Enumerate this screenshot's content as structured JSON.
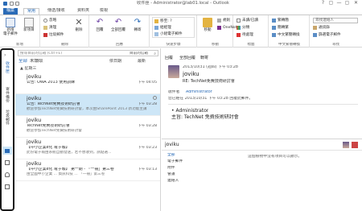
{
  "window": {
    "title": "收件匣 - Administrator@lab01.local - Outlook",
    "controls": [
      "?",
      "▢",
      "—",
      "▢",
      "✕"
    ]
  },
  "tabs": [
    {
      "label": "檔案"
    },
    {
      "label": "常用"
    },
    {
      "label": "傳送/接收"
    },
    {
      "label": "資料夾"
    },
    {
      "label": "檢視"
    }
  ],
  "ribbon": {
    "groups": {
      "new_label": "新增",
      "delete_label": "刪除",
      "respond_label": "回應",
      "quicksteps_label": "快速步驟",
      "move_label": "移動",
      "tags_label": "標籤",
      "convert_label": "中文繁簡轉換",
      "find_label": "尋找"
    },
    "new_email": "新增\n電子郵件",
    "new_items": "新項目",
    "ignore": "忽略",
    "cleanup": "清理",
    "junk": "垃圾郵件",
    "delete": "刪除",
    "reply": "回覆",
    "reply_all": "全部回覆",
    "forward": "轉寄",
    "quickstep_items": [
      "移至: ?",
      "給經理",
      "小組電子郵件"
    ],
    "move": "移動",
    "onenote": "OneNote",
    "rules": "規則",
    "tags_items": [
      "未讀/已讀",
      "分類",
      "待處理"
    ],
    "convert_items": [
      "繁轉簡",
      "簡轉繁",
      "中文繁簡轉換"
    ],
    "find_items": [
      "尋找連絡人",
      "通訊錄",
      "篩選電子郵件"
    ]
  },
  "leftbar": {
    "folders": [
      "收件匣",
      "寄件備份",
      "垃圾郵件"
    ]
  },
  "msglist": {
    "search_placeholder": "搜尋目前的信箱 (Ctrl+E)",
    "scope": "目前的信箱",
    "filter_all": "全部",
    "filter_unread": "未讀取",
    "sort": "依日期",
    "order": "最新",
    "group_header": "▲ 星期三",
    "messages": [
      {
        "sender": "joviku",
        "subject": "公告: OWA 2013 使用訓練",
        "preview": "",
        "date": "下午 04:05"
      },
      {
        "sender": "joviku",
        "subject": "公告: TechNet免費技術研討會",
        "preview": "歡迎參加TechNet免費技術研討會，本次由SharePoint 2013 新功能主講，一起...",
        "date": "下午 03:28"
      },
      {
        "sender": "joviku",
        "subject": "TechNet免費技術研討會",
        "preview": "歡迎參加TechNet免費技術研討會",
        "date": "下午 03:28"
      },
      {
        "sender": "joviku",
        "subject": "【中小企業e化 電子報】",
        "preview": "此份電子報由系統自動發送，若不想收到，請點選...",
        "date": "下午 03:23"
      },
      {
        "sender": "joviku",
        "subject": "【中小企業e化 電子報】 第一期 - 「一冊」第三卷",
        "preview": "由全國中小企業 ... 資訊科技 ... 「一冊」第三卷",
        "date": "下午 03:13"
      }
    ]
  },
  "reading": {
    "reply": "回覆",
    "reply_all": "全部回覆",
    "forward": "轉寄",
    "date_line": "2013/10/31 (週四) 下午 03:28",
    "sender": "joviku",
    "subject_line": "RE: TechNet免費技術研討會",
    "notice": "您已經在 2013/10/31 下午 03:28 回覆此郵件。",
    "to_label": "收件者",
    "to_value": "Administrator",
    "body_to": "• Administrator",
    "body_subject": "主旨: TechNet 免費技術研討會",
    "people_name": "joviku",
    "people_tabs": [
      "全部",
      "電子郵件",
      "附件",
      "會議",
      "連絡人"
    ],
    "people_empty": "這個檢視中沒有項目可以顯示。"
  },
  "colors": {
    "accent": "#2a6bb7",
    "selected": "#cde6f7"
  }
}
